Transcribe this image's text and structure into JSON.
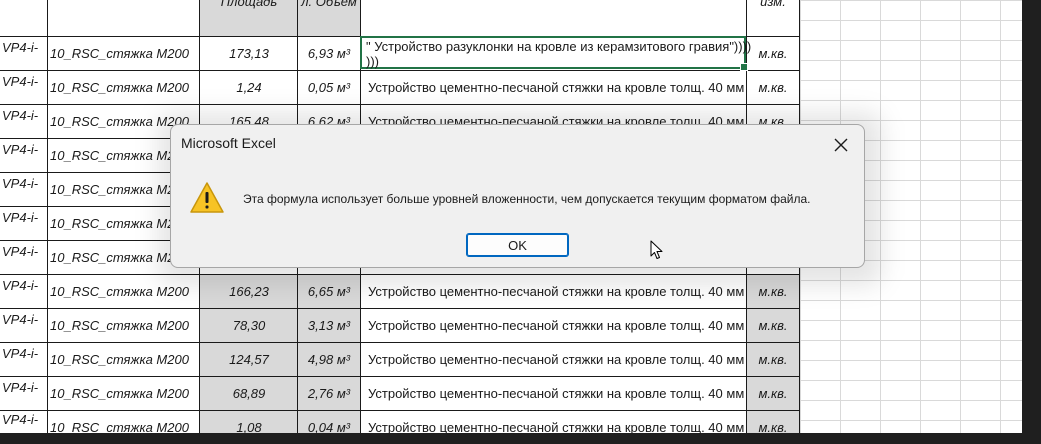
{
  "spreadsheet": {
    "header_cells": {
      "area": "Площадь",
      "volume": "л. Объем",
      "unit": "изм."
    },
    "selected_cell_text": {
      "line1": "\" Устройство разуклонки на кровле из керамзитового гравия\"))))",
      "line2": ")))"
    },
    "rows": [
      {
        "code": "VP4-i-",
        "name": "10_RSC_стяжка M200",
        "area": "173,13",
        "volume": "6,93 м³",
        "desc": "",
        "unit": "м.кв."
      },
      {
        "code": "VP4-i-",
        "name": "10_RSC_стяжка M200",
        "area": "1,24",
        "volume": "0,05 м³",
        "desc": "Устройство цементно-песчаной стяжки на кровле толщ. 40 мм",
        "unit": "м.кв."
      },
      {
        "code": "VP4-i-",
        "name": "10_RSC_стяжка M200",
        "area": "165,48",
        "volume": "6,62 м³",
        "desc": "Устройство цементно-песчаной стяжки на кровле толщ. 40 мм",
        "unit": "м.кв."
      },
      {
        "code": "VP4-i-",
        "name": "10_RSC_стяжка M200",
        "area": "",
        "volume": "",
        "desc": "",
        "unit": ""
      },
      {
        "code": "VP4-i-",
        "name": "10_RSC_стяжка M200",
        "area": "",
        "volume": "",
        "desc": "",
        "unit": ""
      },
      {
        "code": "VP4-i-",
        "name": "10_RSC_стяжка M200",
        "area": "",
        "volume": "",
        "desc": "",
        "unit": ""
      },
      {
        "code": "VP4-i-",
        "name": "10_RSC_стяжка M200",
        "area": "",
        "volume": "",
        "desc": "",
        "unit": ""
      },
      {
        "code": "VP4-i-",
        "name": "10_RSC_стяжка M200",
        "area": "166,23",
        "volume": "6,65 м³",
        "desc": "Устройство цементно-песчаной стяжки на кровле толщ. 40 мм",
        "unit": "м.кв."
      },
      {
        "code": "VP4-i-",
        "name": "10_RSC_стяжка M200",
        "area": "78,30",
        "volume": "3,13 м³",
        "desc": "Устройство цементно-песчаной стяжки на кровле толщ. 40 мм",
        "unit": "м.кв."
      },
      {
        "code": "VP4-i-",
        "name": "10_RSC_стяжка M200",
        "area": "124,57",
        "volume": "4,98 м³",
        "desc": "Устройство цементно-песчаной стяжки на кровле толщ. 40 мм",
        "unit": "м.кв."
      },
      {
        "code": "VP4-i-",
        "name": "10_RSC_стяжка M200",
        "area": "68,89",
        "volume": "2,76 м³",
        "desc": "Устройство цементно-песчаной стяжки на кровле толщ. 40 мм",
        "unit": "м.кв."
      },
      {
        "code": "VP4-i-",
        "name": "10_RSC_стяжка M200",
        "area": "1,08",
        "volume": "0,04 м³",
        "desc": "Устройство цементно-песчаной стяжки на кровле толщ. 40 мм",
        "unit": "м.кв."
      }
    ]
  },
  "dialog": {
    "title": "Microsoft Excel",
    "message": "Эта формула использует больше уровней вложенности, чем допускается текущим форматом файла.",
    "ok_label": "OK"
  },
  "colors": {
    "selection_border": "#217346",
    "button_focus": "#0067c0",
    "warning": "#f7c325"
  },
  "icons": {
    "warning": "warning-icon",
    "close": "close-icon",
    "cursor": "mouse-pointer-icon"
  }
}
